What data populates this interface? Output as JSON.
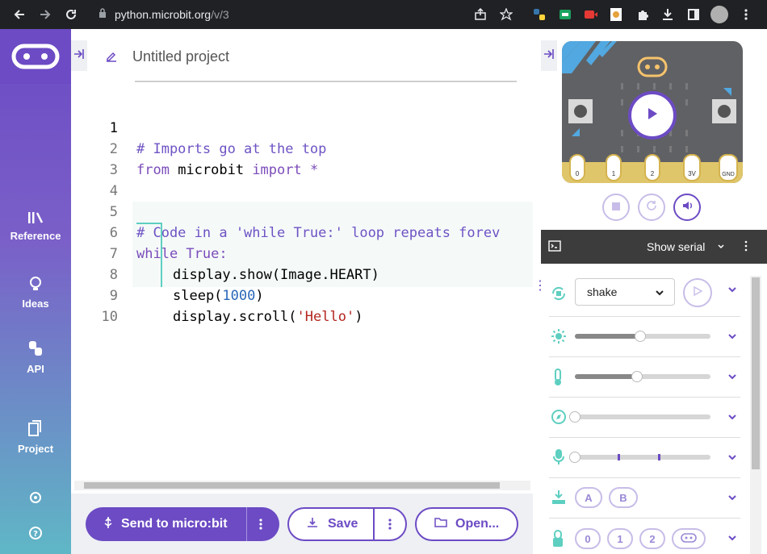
{
  "browser": {
    "url_host": "python.microbit.org",
    "url_path": "/v/3"
  },
  "sidebar": {
    "items": [
      {
        "label": "Reference",
        "icon": "reference-icon"
      },
      {
        "label": "Ideas",
        "icon": "lightbulb-icon"
      },
      {
        "label": "API",
        "icon": "python-icon"
      },
      {
        "label": "Project",
        "icon": "files-icon"
      }
    ]
  },
  "editor": {
    "project_name": "Untitled project",
    "line_numbers": [
      "1",
      "2",
      "3",
      "4",
      "5",
      "6",
      "7",
      "8",
      "9",
      "10"
    ],
    "code": {
      "l1": "# Imports go at the top",
      "l2_kw1": "from",
      "l2_mod": " microbit ",
      "l2_kw2": "import",
      "l2_star": " *",
      "l5": "# Code in a 'while True:' loop repeats forev",
      "l6_kw": "while",
      "l6_rest": " True:",
      "l7": "display.show(Image.HEART)",
      "l8_a": "sleep(",
      "l8_num": "1000",
      "l8_b": ")",
      "l9_a": "display.scroll(",
      "l9_str": "'Hello'",
      "l9_b": ")"
    }
  },
  "toolbar": {
    "send_label": "Send to micro:bit",
    "save_label": "Save",
    "open_label": "Open..."
  },
  "simulator": {
    "pins": [
      "0",
      "1",
      "2",
      "3V",
      "GND"
    ],
    "serial_label": "Show serial",
    "gesture_value": "shake",
    "button_labels": [
      "A",
      "B"
    ],
    "pin_labels": [
      "0",
      "1",
      "2"
    ],
    "light_level": 0.48,
    "temperature_level": 0.46,
    "compass_level": 0.0,
    "sound_level": 0.0
  },
  "colors": {
    "accent": "#6c4bc4",
    "teal": "#5ecfc0"
  }
}
